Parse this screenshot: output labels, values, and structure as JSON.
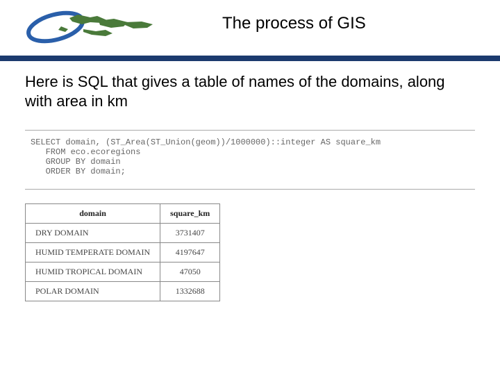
{
  "title": "The process of GIS",
  "intro": "Here is SQL that gives a table of names of the domains, along with area in km",
  "sql": {
    "line1": "SELECT domain, (ST_Area(ST_Union(geom))/1000000)::integer AS square_km",
    "line2": "   FROM eco.ecoregions",
    "line3": "   GROUP BY domain",
    "line4": "   ORDER BY domain;"
  },
  "table": {
    "headers": {
      "col1": "domain",
      "col2": "square_km"
    },
    "rows": [
      {
        "domain": "DRY DOMAIN",
        "square_km": "3731407"
      },
      {
        "domain": "HUMID TEMPERATE DOMAIN",
        "square_km": "4197647"
      },
      {
        "domain": "HUMID TROPICAL DOMAIN",
        "square_km": "47050"
      },
      {
        "domain": "POLAR DOMAIN",
        "square_km": "1332688"
      }
    ]
  }
}
